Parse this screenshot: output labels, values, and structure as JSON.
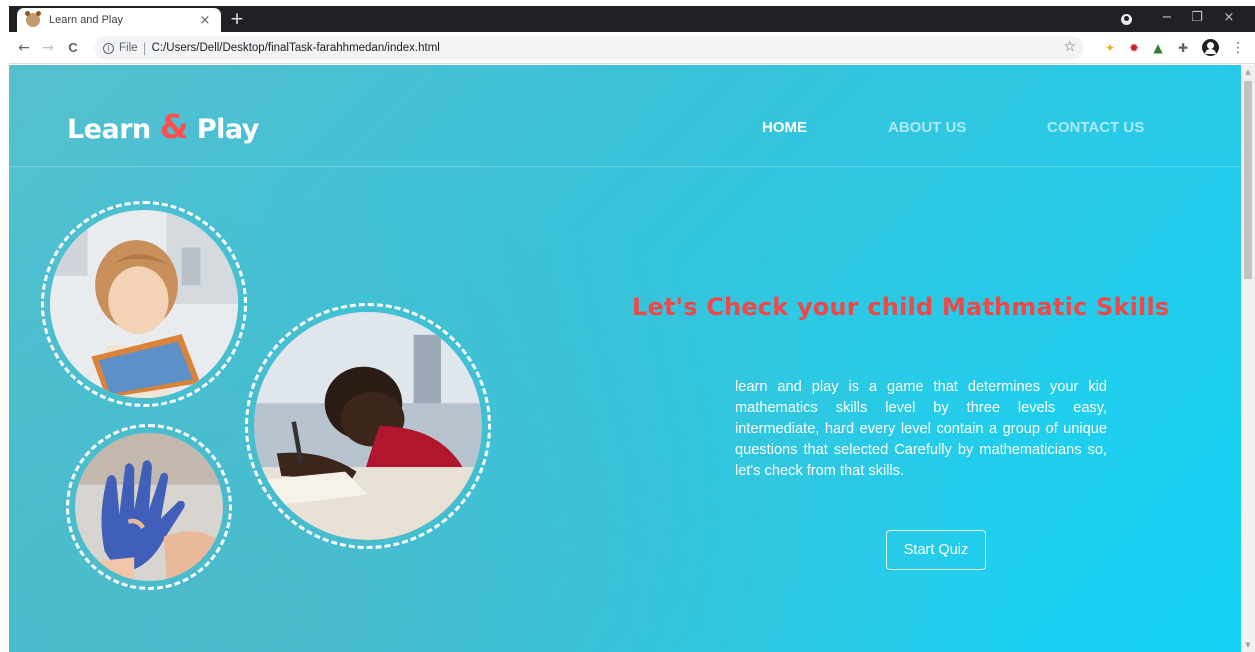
{
  "browser": {
    "tab_title": "Learn and Play",
    "tab_close": "×",
    "new_tab": "+",
    "window_controls": [
      "−",
      "❐",
      "×"
    ],
    "file_label": "File",
    "separator": "|",
    "url": "C:/Users/Dell/Desktop/finalTask-farahhmedan/index.html",
    "back": "←",
    "forward": "→",
    "reload": "C",
    "bookmark_star": "☆",
    "menu": "⋮"
  },
  "site": {
    "logo_part1": "Learn ",
    "logo_amp": "&",
    "logo_part2": " Play",
    "nav": [
      "HOME",
      "ABOUT US",
      "CONTACT US"
    ],
    "headline": "Let's Check your child Mathmatic Skills",
    "description": "learn and play is a game that determines your kid mathematics skills level by three levels easy, intermediate, hard every level contain a group of unique questions that selected Carefully by mathematicians so, let's check from that skills.",
    "cta": "Start Quiz"
  },
  "colors": {
    "accent_red": "#f04848",
    "bg_cyan": "#22cdec",
    "tab_bar": "#202124"
  }
}
